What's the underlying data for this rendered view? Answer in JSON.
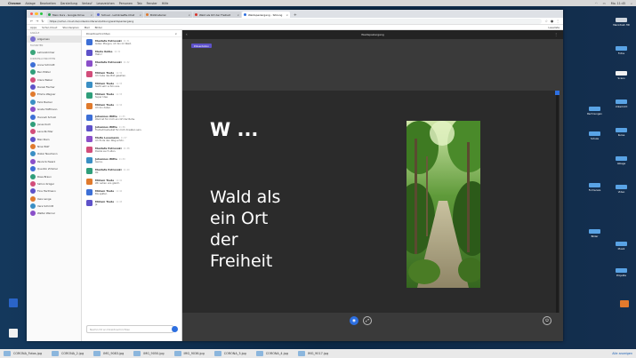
{
  "menubar": {
    "apple": "",
    "items": [
      "Chrome",
      "Ablage",
      "Bearbeiten",
      "Darstellung",
      "Verlauf",
      "Lesezeichen",
      "Personen",
      "Tab",
      "Fenster",
      "Hilfe"
    ],
    "right": [
      "Mo. 11:45"
    ]
  },
  "browser": {
    "tabs": [
      {
        "label": "Mein Kurs - Google Drive"
      },
      {
        "label": "Schuel - Lehrkraefte-Chat"
      },
      {
        "label": "Bildmaterial"
      },
      {
        "label": "Wald als Ort der Freiheit"
      },
      {
        "label": "Waldspaziergang - Sitzung"
      }
    ],
    "url": "https://schul-cloud.de/videokonferenz/sitzung/waldspaziergang",
    "bookmarks": [
      "Apps",
      "Schul-Cloud",
      "Stundenplan",
      "Mail",
      "Bilder"
    ],
    "reading_list": "Leseliste"
  },
  "sidebar": {
    "sections": [
      {
        "title": "KANÄLE",
        "items": [
          "Allgemein"
        ]
      },
      {
        "title": "FAVORITEN",
        "items": [
          "Lehrerzimmer"
        ]
      },
      {
        "title": "DIREKTNACHRICHTEN",
        "items": [
          "Anna Schmidt",
          "Ben Müller",
          "Clara Weber",
          "Daniel Fischer",
          "Emma Wagner",
          "Felix Becker",
          "Greta Hoffmann",
          "Hannah Schulz",
          "Jonas Koch",
          "Lena Richter",
          "Max Klein",
          "Nina Wolf",
          "Oskar Neumann",
          "Paula Schwarz",
          "Quentin Zimmer",
          "Rosa Braun",
          "Simon Krüger",
          "Tina Hartmann",
          "Uwe Lange",
          "Vera Schmitt",
          "Walter Werner"
        ]
      }
    ]
  },
  "chat": {
    "header": "Direktnachrichten",
    "messages": [
      {
        "name": "Mustafa Petrovski",
        "time": "11:31",
        "text": "Guten Morgen, ich bin im Wald."
      },
      {
        "name": "Marie Kolbe",
        "time": "11:31",
        "text": "Hallo!"
      },
      {
        "name": "Mustafa Petrovski",
        "time": "11:32",
        "text": "Ja"
      },
      {
        "name": "Miriam Tiede",
        "time": "11:32",
        "text": "Ich habe das Bild gesehen."
      },
      {
        "name": "Miriam Tiede",
        "time": "11:33",
        "text": "Sieht sehr schön aus."
      },
      {
        "name": "Miriam Tiede",
        "time": "11:33",
        "text": "Super Idee"
      },
      {
        "name": "Miriam Tiede",
        "time": "11:34",
        "text": "Ich bin dabei."
      },
      {
        "name": "Johannes Witte",
        "time": "11:35",
        "text": "Wald ist für mich ein Ort der Ruhe."
      },
      {
        "name": "Johannes Witte",
        "time": "11:36",
        "text": "Freiheit bedeutet für mich draußen sein."
      },
      {
        "name": "Malte Lesemann",
        "time": "11:37",
        "text": "Ich finde den Weg schön."
      },
      {
        "name": "Mustafa Petrovski",
        "time": "11:38",
        "text": "Danke euch allen."
      },
      {
        "name": "Johannes Witte",
        "time": "11:39",
        "text": "Gerne."
      },
      {
        "name": "Mustafa Petrovski",
        "time": "11:40",
        "text": "Ok"
      },
      {
        "name": "Miriam Tiede",
        "time": "11:41",
        "text": "Wir sehen uns gleich."
      },
      {
        "name": "Miriam Tiede",
        "time": "11:42",
        "text": "Bis später."
      },
      {
        "name": "Miriam Tiede",
        "time": "11:43",
        "text": "Ja"
      }
    ],
    "composer_placeholder": "Nachricht an Direktnachrichten"
  },
  "stage": {
    "title": "Waldspaziergang",
    "tag": "Präsentation",
    "slide_title": "W ...",
    "slide_lines": [
      "Wald als",
      "ein Ort",
      "der",
      "Freiheit"
    ]
  },
  "downloads": {
    "items": [
      "CORONA_Fotos.jpg",
      "CORONA_2.jpg",
      "IMG_9083.jpg",
      "IMG_9050.jpg",
      "IMG_9036.jpg",
      "CORONA_3.jpg",
      "CORONA_4.jpg",
      "IMG_9017.jpg"
    ],
    "show_all": "Alle anzeigen"
  },
  "desktop": {
    "icons": [
      "Macintosh HD",
      "Fotos",
      "Scans",
      "Unterricht",
      "Rechnungen",
      "Kurse",
      "Schule",
      "Ablage",
      "Formulare",
      "Video",
      "Bilder",
      "Musik",
      "Projekte"
    ]
  },
  "colors": {
    "accent": "#2d6fe0",
    "tag": "#5e52c9",
    "stage_bg": "#3a3a3a",
    "slide_bg": "#2b2b2b"
  }
}
